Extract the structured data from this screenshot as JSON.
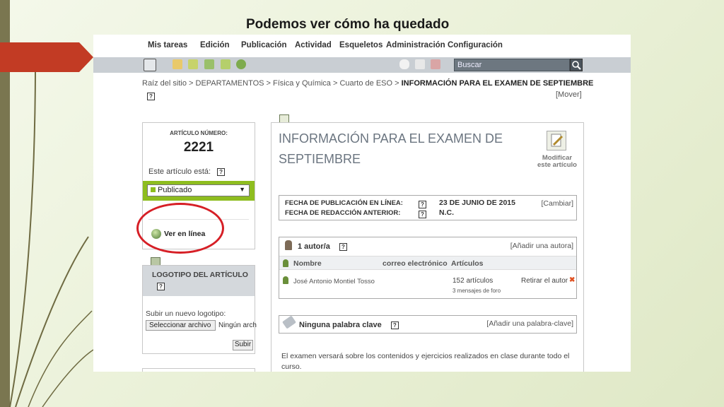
{
  "slide": {
    "title": "Podemos ver cómo ha quedado"
  },
  "menu": {
    "items": [
      "Mis tareas",
      "Edición",
      "Publicación",
      "Actividad",
      "Esqueletos",
      "Administración",
      "Configuración"
    ]
  },
  "toolbar": {
    "search_placeholder": "Buscar"
  },
  "breadcrumb": {
    "path": "Raíz del sitio > DEPARTAMENTOS > Física y Química > Cuarto de ESO > ",
    "current": "INFORMACIÓN PARA EL EXAMEN DE SEPTIEMBRE",
    "mover": "[Mover]"
  },
  "help_glyph": "?",
  "article": {
    "number_label": "ARTÍCULO NÚMERO:",
    "number": "2221",
    "status_label": "Este artículo está:",
    "status_value": "Publicado",
    "view_online": "Ver en línea"
  },
  "logo": {
    "title": "LOGOTIPO DEL ARTÍCULO",
    "upload_label": "Subir un nuevo logotipo:",
    "file_button": "Seleccionar archivo",
    "file_status": "Ningún arch",
    "submit": "Subir"
  },
  "main": {
    "title_line1": "INFORMACIÓN PARA EL EXAMEN DE",
    "title_line2": "SEPTIEMBRE",
    "modify_line1": "Modificar",
    "modify_line2": "este artículo",
    "pub_date_label": "FECHA DE PUBLICACIÓN EN LÍNEA:",
    "pub_date_value": "23 DE JUNIO DE 2015",
    "prev_date_label": "FECHA DE REDACCIÓN ANTERIOR:",
    "prev_date_value": "N.C.",
    "change": "[Cambiar]",
    "authors_heading": "1 autor/a",
    "add_author": "[Añadir una autora]",
    "col_name": "Nombre",
    "col_email": "correo electrónico",
    "col_articles": "Artículos",
    "author_name": "José Antonio Montiel Tosso",
    "author_articles": "152 artículos",
    "author_messages": "3 mensajes de foro",
    "remove_author": "Retirar el autor",
    "remove_glyph": "✖",
    "keywords_heading": "Ninguna palabra clave",
    "add_keyword": "[Añadir una palabra-clave]",
    "description": "El examen versará sobre los contenidos y ejercicios realizados en clase durante todo el curso."
  },
  "colors": {
    "status_green": "#8ebd1f",
    "highlight_red": "#d61f26",
    "arrow_red": "#c23b24",
    "toolbar_gray": "#c9ced3"
  }
}
